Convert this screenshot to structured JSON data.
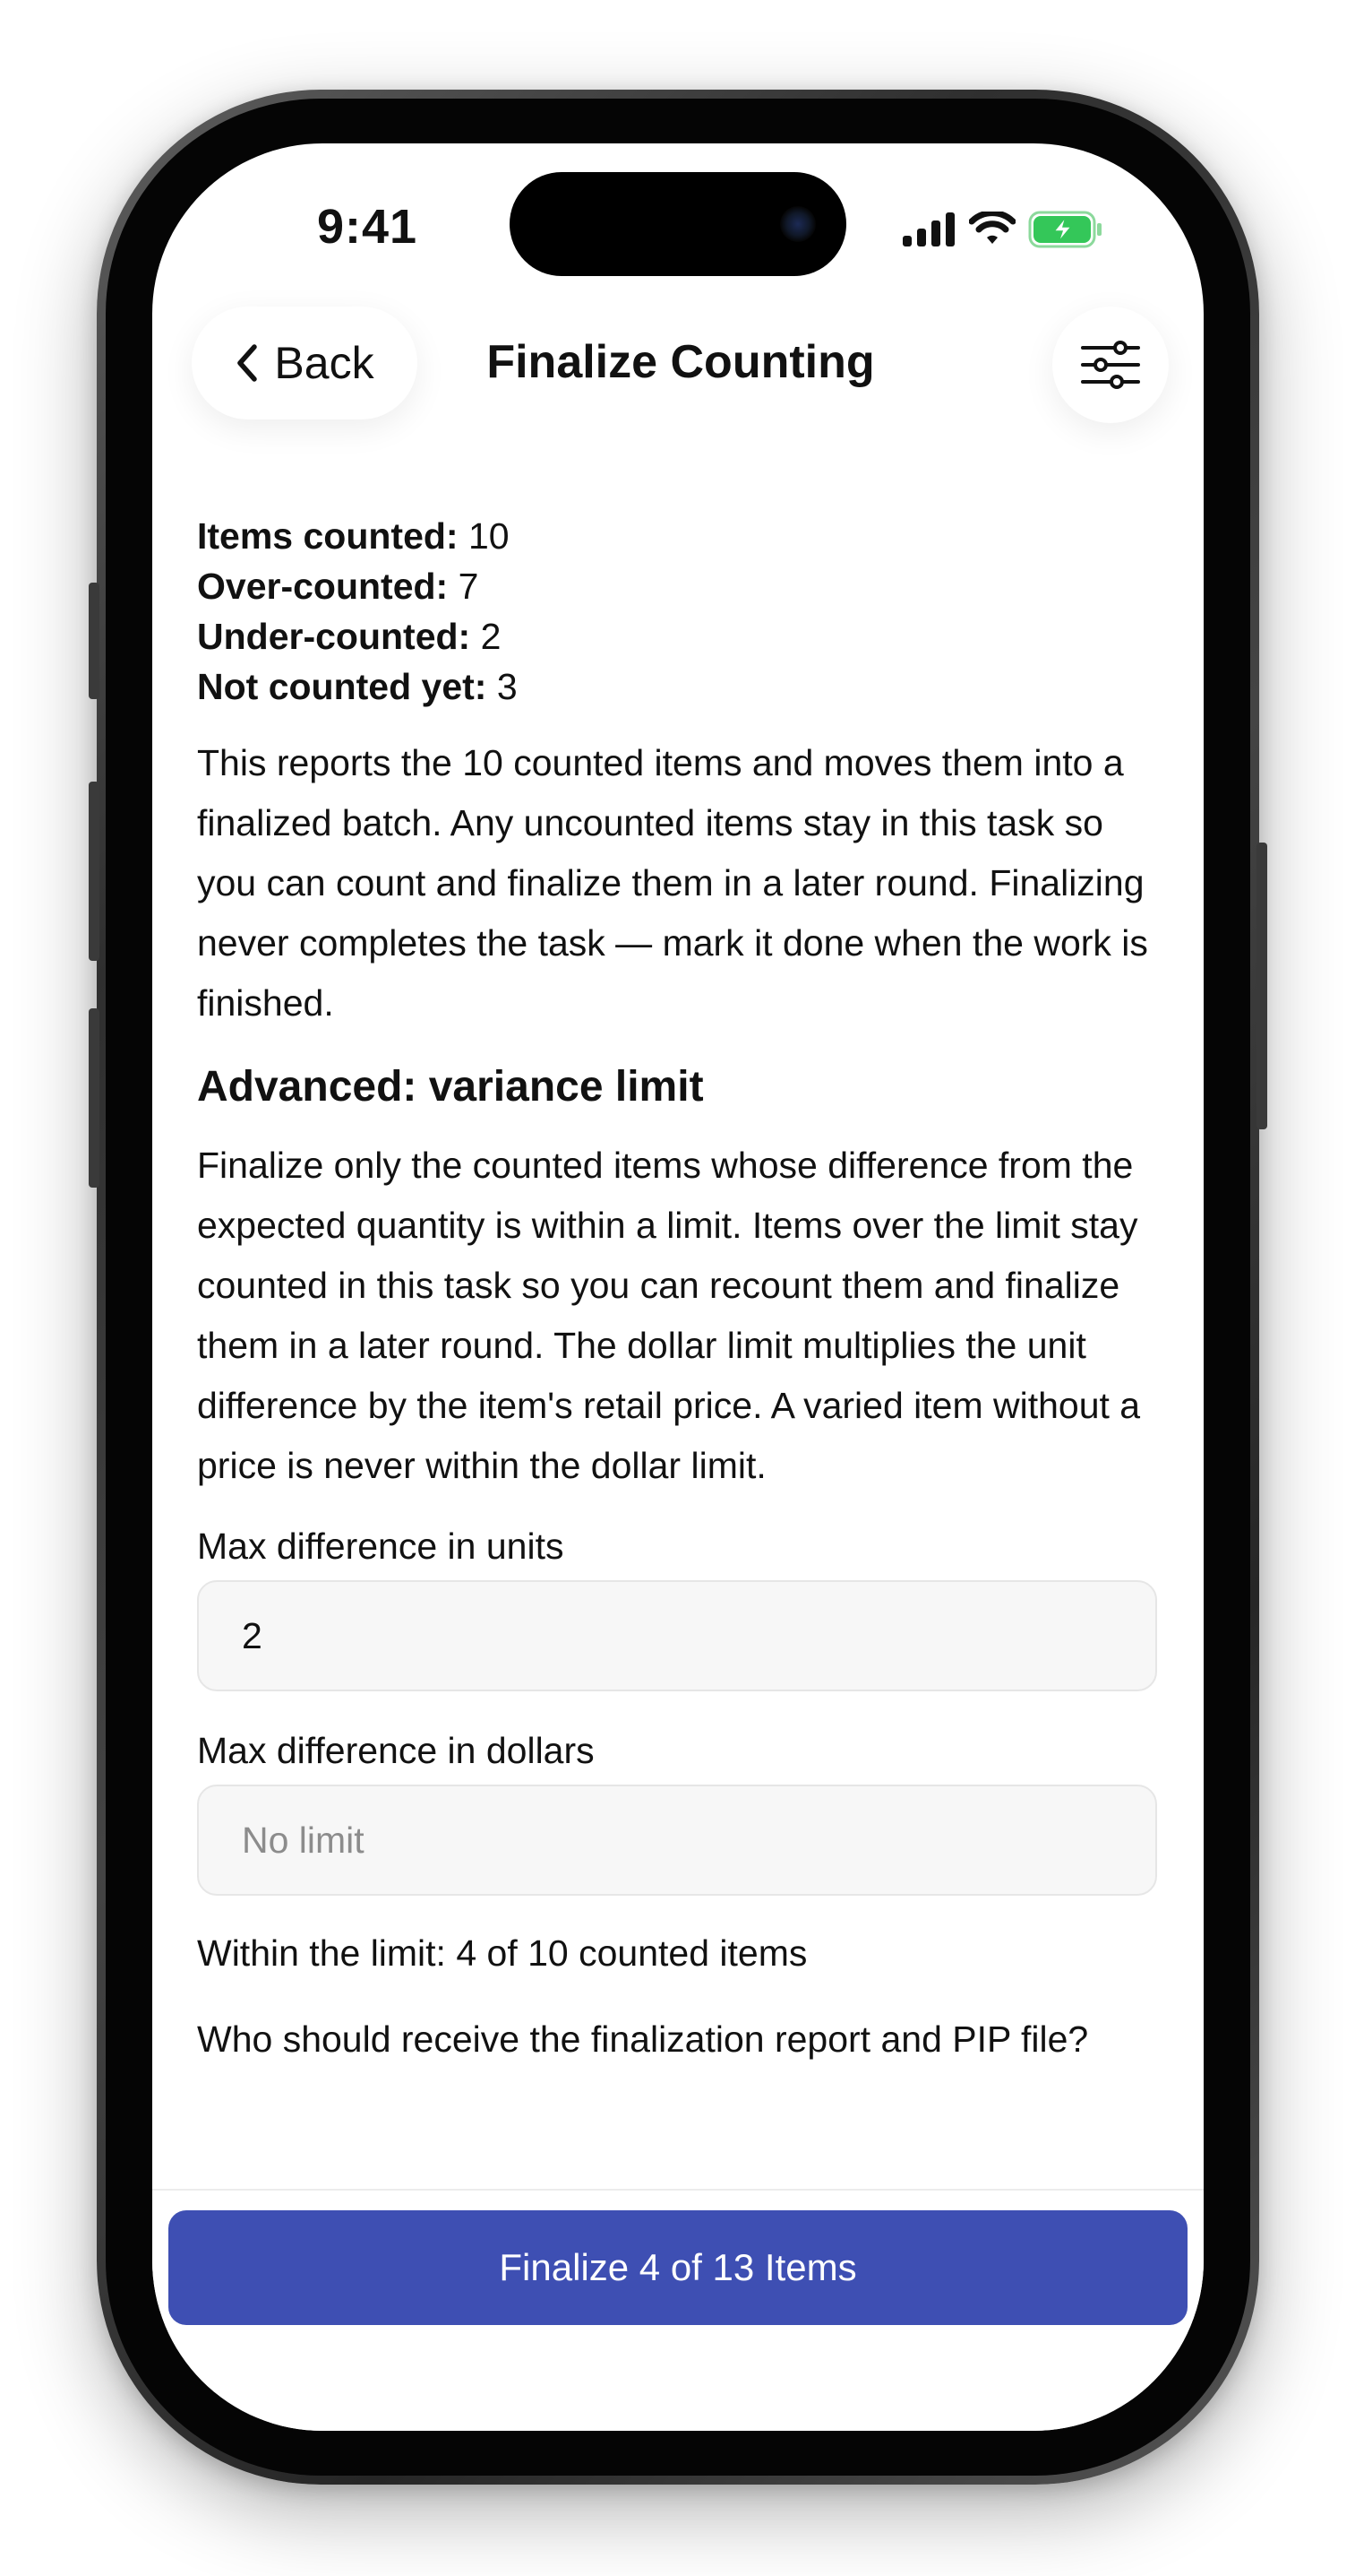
{
  "status_bar": {
    "time": "9:41"
  },
  "nav": {
    "back_label": "Back",
    "title": "Finalize Counting"
  },
  "summary": [
    {
      "label": "Items counted:",
      "value": "10"
    },
    {
      "label": "Over-counted:",
      "value": "7"
    },
    {
      "label": "Under-counted:",
      "value": "2"
    },
    {
      "label": "Not counted yet:",
      "value": "3"
    }
  ],
  "intro_text": "This reports the 10 counted items and moves them into a finalized batch. Any uncounted items stay in this task so you can count and finalize them in a later round. Finalizing never completes the task — mark it done when the work is finished.",
  "advanced": {
    "title": "Advanced: variance limit",
    "description": "Finalize only the counted items whose difference from the expected quantity is within a limit. Items over the limit stay counted in this task so you can recount them and finalize them in a later round. The dollar limit multiplies the unit difference by the item's retail price. A varied item without a price is never within the dollar limit.",
    "units_label": "Max difference in units",
    "units_value": "2",
    "dollars_label": "Max difference in dollars",
    "dollars_placeholder": "No limit",
    "within_text": "Within the limit: 4 of 10 counted items"
  },
  "recipient_prompt": "Who should receive the finalization report and PIP file?",
  "primary_button": "Finalize 4 of 13 Items",
  "colors": {
    "primary": "#3e4fb3",
    "battery": "#34c759"
  }
}
